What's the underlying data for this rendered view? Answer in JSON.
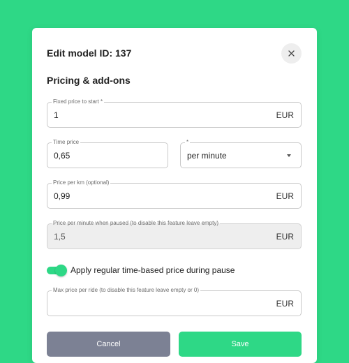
{
  "modal": {
    "title": "Edit model ID: 137",
    "section_title": "Pricing & add-ons"
  },
  "icons": {
    "close": "close-icon",
    "dropdown": "caret-down-icon"
  },
  "colors": {
    "background": "#2ed886",
    "accent": "#2ed886",
    "cancel_button": "#7c8194"
  },
  "fields": {
    "fixed_price": {
      "label": "Fixed price to start *",
      "value": "1",
      "suffix": "EUR"
    },
    "time_price": {
      "label": "Time price",
      "value": "0,65"
    },
    "time_unit": {
      "label": "*",
      "value": "per minute"
    },
    "price_per_km": {
      "label": "Price per km (optional)",
      "value": "0,99",
      "suffix": "EUR"
    },
    "paused_price": {
      "label": "Price per minute when paused (to disable this feature leave empty)",
      "value": "1,5",
      "suffix": "EUR",
      "disabled": true
    },
    "max_price": {
      "label": "Max price per ride (to disable this feature leave empty or 0)",
      "value": "",
      "suffix": "EUR"
    }
  },
  "toggle": {
    "label": "Apply regular time-based price during pause",
    "on": true
  },
  "buttons": {
    "cancel": "Cancel",
    "save": "Save"
  }
}
